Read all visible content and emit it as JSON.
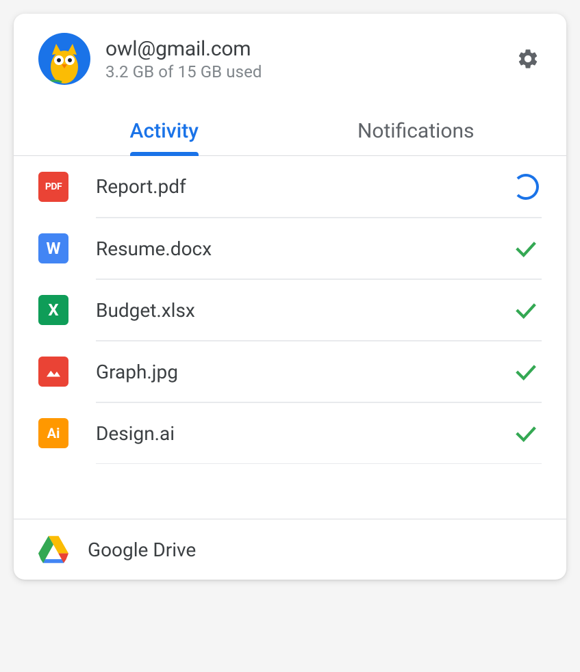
{
  "account": {
    "email": "owl@gmail.com",
    "storage": "3.2 GB of 15 GB used"
  },
  "tabs": [
    {
      "label": "Activity",
      "active": true
    },
    {
      "label": "Notifications",
      "active": false
    }
  ],
  "files": [
    {
      "name": "Report.pdf",
      "type": "pdf",
      "status": "syncing"
    },
    {
      "name": "Resume.docx",
      "type": "docx",
      "status": "done"
    },
    {
      "name": "Budget.xlsx",
      "type": "xlsx",
      "status": "done"
    },
    {
      "name": "Graph.jpg",
      "type": "jpg",
      "status": "done"
    },
    {
      "name": "Design.ai",
      "type": "ai",
      "status": "done"
    }
  ],
  "footer": {
    "label": "Google Drive"
  },
  "icons": {
    "pdf": "PDF",
    "docx": "W",
    "xlsx": "X",
    "ai": "Ai"
  }
}
